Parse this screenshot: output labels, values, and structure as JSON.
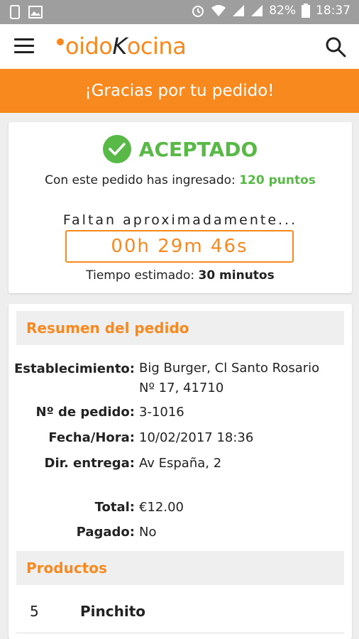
{
  "status_bar": {
    "battery": "82%",
    "time": "18:37"
  },
  "app_bar": {
    "logo_prefix": "oido",
    "logo_k": "K",
    "logo_suffix": "ocina"
  },
  "banner": {
    "text": "¡Gracias por tu pedido!"
  },
  "order_status": {
    "status": "ACEPTADO",
    "points_prefix": "Con este pedido has ingresado:",
    "points_value": "120 puntos",
    "remaining_label": "Faltan aproximadamente...",
    "countdown": "00h 29m 46s",
    "estimated_prefix": "Tiempo estimado:",
    "estimated_value": "30 minutos"
  },
  "summary": {
    "title": "Resumen del pedido",
    "establishment_label": "Establecimiento:",
    "establishment_value": "Big Burger, Cl Santo Rosario Nº 17, 41710",
    "order_number_label": "Nº de pedido:",
    "order_number_value": "3-1016",
    "datetime_label": "Fecha/Hora:",
    "datetime_value": "10/02/2017 18:36",
    "address_label": "Dir. entrega:",
    "address_value": "Av España, 2",
    "total_label": "Total:",
    "total_value": "€12.00",
    "paid_label": "Pagado:",
    "paid_value": "No"
  },
  "products": {
    "title": "Productos",
    "items": [
      {
        "qty": "5",
        "name": "Pinchito"
      }
    ]
  },
  "colors": {
    "accent": "#f7891f",
    "success": "#58b947",
    "status_bar": "#9e9e9e"
  }
}
